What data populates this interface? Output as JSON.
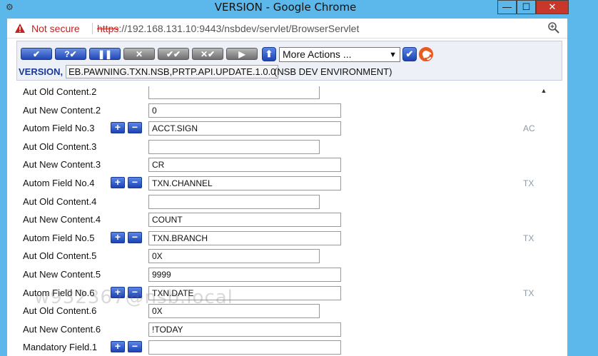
{
  "window": {
    "title": "VERSION - Google Chrome",
    "minimize": "—",
    "maximize": "☐",
    "close": "✕"
  },
  "address": {
    "security_label": "Not secure",
    "url_scheme": "https",
    "url_rest": "://192.168.131.10:9443/nsbdev/servlet/BrowserServlet"
  },
  "toolbar": {
    "actions_value": "More Actions ...",
    "version_label": "VERSION,",
    "version_name": "EB.PAWNING.TXN.NSB,PRTP.API.UPDATE.1.0.0",
    "environment": "(NSB DEV ENVIRONMENT)"
  },
  "rows": [
    {
      "label": "Aut Old Content.2",
      "value": "",
      "kind": "short",
      "pm": false,
      "ref": ""
    },
    {
      "label": "Aut New Content.2",
      "value": "0",
      "kind": "long",
      "pm": false,
      "ref": ""
    },
    {
      "label": "Autom Field No.3",
      "value": "ACCT.SIGN",
      "kind": "long",
      "pm": true,
      "ref": "AC"
    },
    {
      "label": "Aut Old Content.3",
      "value": "",
      "kind": "short",
      "pm": false,
      "ref": ""
    },
    {
      "label": "Aut New Content.3",
      "value": "CR",
      "kind": "long",
      "pm": false,
      "ref": ""
    },
    {
      "label": "Autom Field No.4",
      "value": "TXN.CHANNEL",
      "kind": "long",
      "pm": true,
      "ref": "TX"
    },
    {
      "label": "Aut Old Content.4",
      "value": "",
      "kind": "short",
      "pm": false,
      "ref": ""
    },
    {
      "label": "Aut New Content.4",
      "value": "COUNT",
      "kind": "long",
      "pm": false,
      "ref": ""
    },
    {
      "label": "Autom Field No.5",
      "value": "TXN.BRANCH",
      "kind": "long",
      "pm": true,
      "ref": "TX"
    },
    {
      "label": "Aut Old Content.5",
      "value": "0X",
      "kind": "short",
      "pm": false,
      "ref": ""
    },
    {
      "label": "Aut New Content.5",
      "value": "9999",
      "kind": "long",
      "pm": false,
      "ref": ""
    },
    {
      "label": "Autom Field No.6",
      "value": "TXN.DATE",
      "kind": "long",
      "pm": true,
      "ref": "TX"
    },
    {
      "label": "Aut Old Content.6",
      "value": "0X",
      "kind": "short",
      "pm": false,
      "ref": ""
    },
    {
      "label": "Aut New Content.6",
      "value": "!TODAY",
      "kind": "long",
      "pm": false,
      "ref": ""
    },
    {
      "label": "Mandatory Field.1",
      "value": "",
      "kind": "long",
      "pm": true,
      "ref": ""
    }
  ],
  "watermark": "w932367@nsb.local",
  "icons": {
    "warning": "warning-triangle-icon",
    "zoom": "magnifier-icon",
    "help": "lifebuoy-icon"
  },
  "colors": {
    "titlebar": "#5cb8ea",
    "close": "#c7382b",
    "toolbar_blue": "#2248b8",
    "toolbar_gray": "#707070",
    "not_secure": "#c5221f"
  }
}
